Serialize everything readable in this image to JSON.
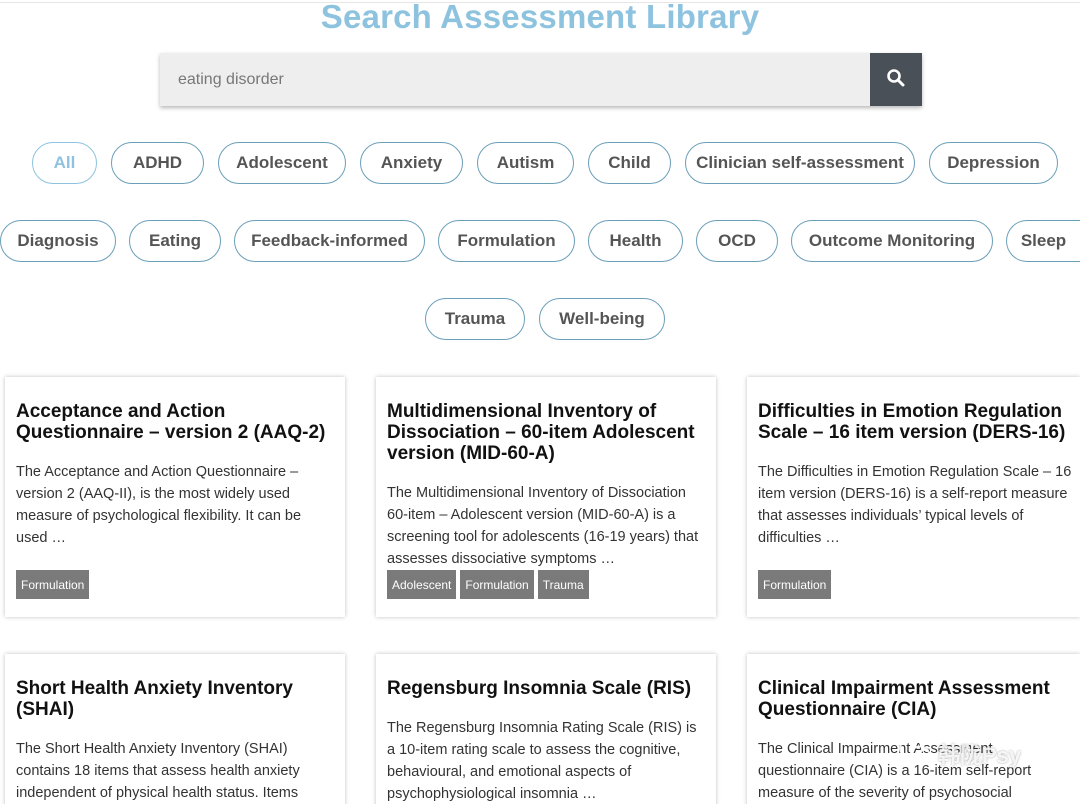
{
  "header": {
    "title": "Search Assessment Library"
  },
  "search": {
    "value": "eating disorder"
  },
  "filters": [
    "All",
    "ADHD",
    "Adolescent",
    "Anxiety",
    "Autism",
    "Child",
    "Clinician self-assessment",
    "Depression",
    "Diagnosis",
    "Eating",
    "Feedback-informed",
    "Formulation",
    "Health",
    "OCD",
    "Outcome Monitoring",
    "Sleep",
    "Trauma",
    "Well-being"
  ],
  "active_filter": "All",
  "cards": [
    {
      "title": "Acceptance and Action Questionnaire – version 2 (AAQ-2)",
      "description": "The Acceptance and Action Questionnaire – version 2 (AAQ-II), is the most widely used measure of psychological flexibility. It can be used …",
      "tags": [
        "Formulation"
      ]
    },
    {
      "title": "Multidimensional Inventory of Dissociation – 60-item Adolescent version (MID-60-A)",
      "description": "The Multidimensional Inventory of Dissociation 60-item – Adolescent version (MID-60-A) is a screening tool for adolescents (16-19 years) that assesses dissociative symptoms …",
      "tags": [
        "Adolescent",
        "Formulation",
        "Trauma"
      ]
    },
    {
      "title": "Difficulties in Emotion Regulation Scale – 16 item version (DERS-16)",
      "description": "The Difficulties in Emotion Regulation Scale – 16 item version (DERS-16) is a self-report measure that assesses individuals’ typical levels of difficulties …",
      "tags": [
        "Formulation"
      ]
    },
    {
      "title": "Short Health Anxiety Inventory (SHAI)",
      "description": "The Short Health Anxiety Inventory (SHAI) contains 18 items that assess health anxiety independent of physical health status. Items",
      "tags": []
    },
    {
      "title": "Regensburg Insomnia Scale (RIS)",
      "description": "The Regensburg Insomnia Rating Scale (RIS) is a 10-item rating scale to assess the cognitive, behavioural, and emotional aspects of psychophysiological insomnia …",
      "tags": []
    },
    {
      "title": "Clinical Impairment Assessment Questionnaire (CIA)",
      "description": "The Clinical Impairment Assessment questionnaire (CIA) is a 16-item self-report measure of the severity of psychosocial",
      "tags": []
    }
  ],
  "watermark": {
    "text": "韩陇Psy"
  },
  "colors": {
    "accent": "#8ec3df",
    "pill_border": "#6b9fb9",
    "search_button": "#4a5057",
    "tag_bg": "#7a7a7a"
  },
  "icons": {
    "search_button": "search-icon",
    "watermark": "wechat-icon"
  }
}
